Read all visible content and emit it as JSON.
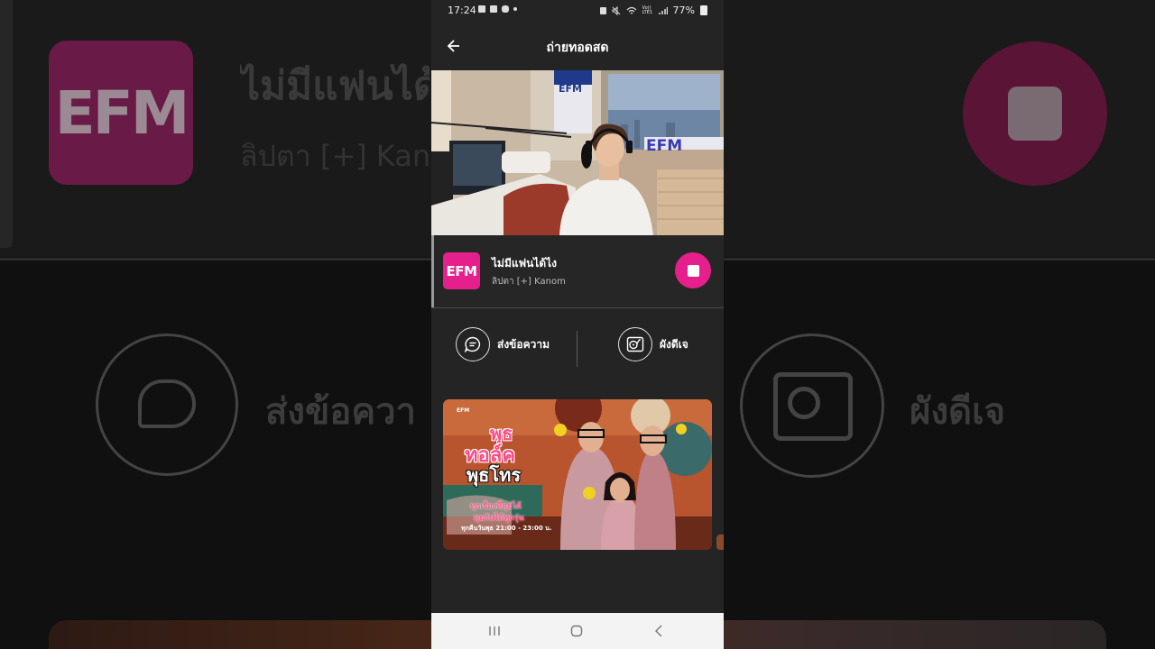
{
  "status_bar": {
    "time": "17:24",
    "network": "Vo)) LTE1",
    "battery": "77%"
  },
  "header": {
    "title": "ถ่ายทอดสด"
  },
  "video": {
    "studio_logo_text": "EFM",
    "window_logo_text": "EFM"
  },
  "player": {
    "station_logo": "EFM",
    "song_title": "ไม่มีแฟนได้ไง",
    "artist": "ลิปตา [+] Kanom",
    "accent_color": "#e5208d"
  },
  "actions": {
    "send_message": "ส่งข้อความ",
    "dj_schedule": "ผังดีเจ"
  },
  "banner": {
    "brand": "EFM",
    "show_title_line1": "พุธ",
    "show_title_line2": "ทอล์ค",
    "show_title_line3": "พุธโทร",
    "tagline1": "ทุกเรื่องที่คุยได้",
    "tagline2": "คุยกันได้ทุกรุ่น",
    "airtime": "ทุกคืนวันพุธ 21:00 - 23:00 น."
  },
  "background": {
    "logo": "EFM",
    "title": "ไม่มีแฟนได้ไ",
    "subtitle": "ลิปตา [+] Kan",
    "send_label": "ส่งข้อควา",
    "dj_label": "ผังดีเจ"
  },
  "icons": {
    "back": "arrow-left-icon",
    "stop": "stop-icon",
    "message": "chat-bubble-icon",
    "dj": "turntable-icon",
    "nav_recent": "recent-apps-icon",
    "nav_home": "home-icon",
    "nav_back": "nav-back-icon"
  }
}
